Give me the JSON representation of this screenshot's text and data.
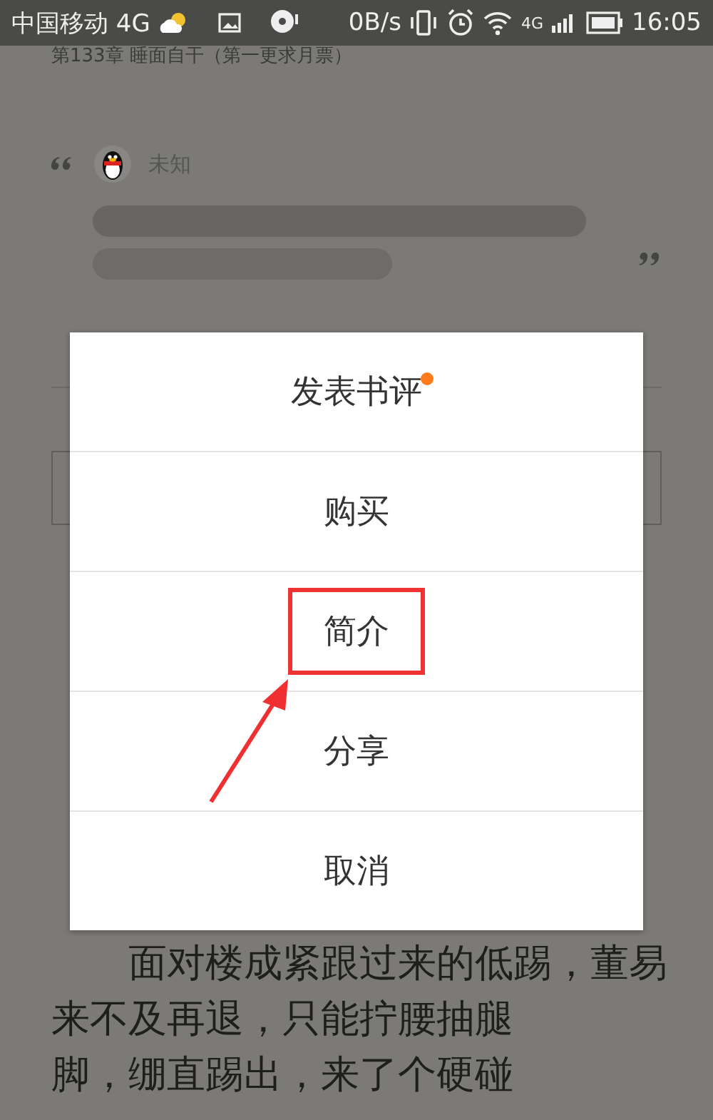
{
  "status_bar": {
    "carrier": "中国移动 4G",
    "speed": "0B/s",
    "network": "4G",
    "time": "16:05"
  },
  "chapter_title": "第133章 睡面自干（第一更求月票）",
  "comment": {
    "author": "未知"
  },
  "menu": {
    "items": [
      {
        "label": "发表书评",
        "dot": true,
        "highlighted": false
      },
      {
        "label": "购买",
        "dot": false,
        "highlighted": false
      },
      {
        "label": "简介",
        "dot": false,
        "highlighted": true
      },
      {
        "label": "分享",
        "dot": false,
        "highlighted": false
      },
      {
        "label": "取消",
        "dot": false,
        "highlighted": false
      }
    ]
  },
  "body": {
    "lines": [
      {
        "text": "面对楼成紧跟过来的低踢，董易",
        "indent": true
      },
      {
        "text": "来不及再退，只能拧腰抽腿",
        "indent": false
      },
      {
        "text": "脚，绷直踢出，来了个硬碰",
        "indent": false
      }
    ]
  }
}
